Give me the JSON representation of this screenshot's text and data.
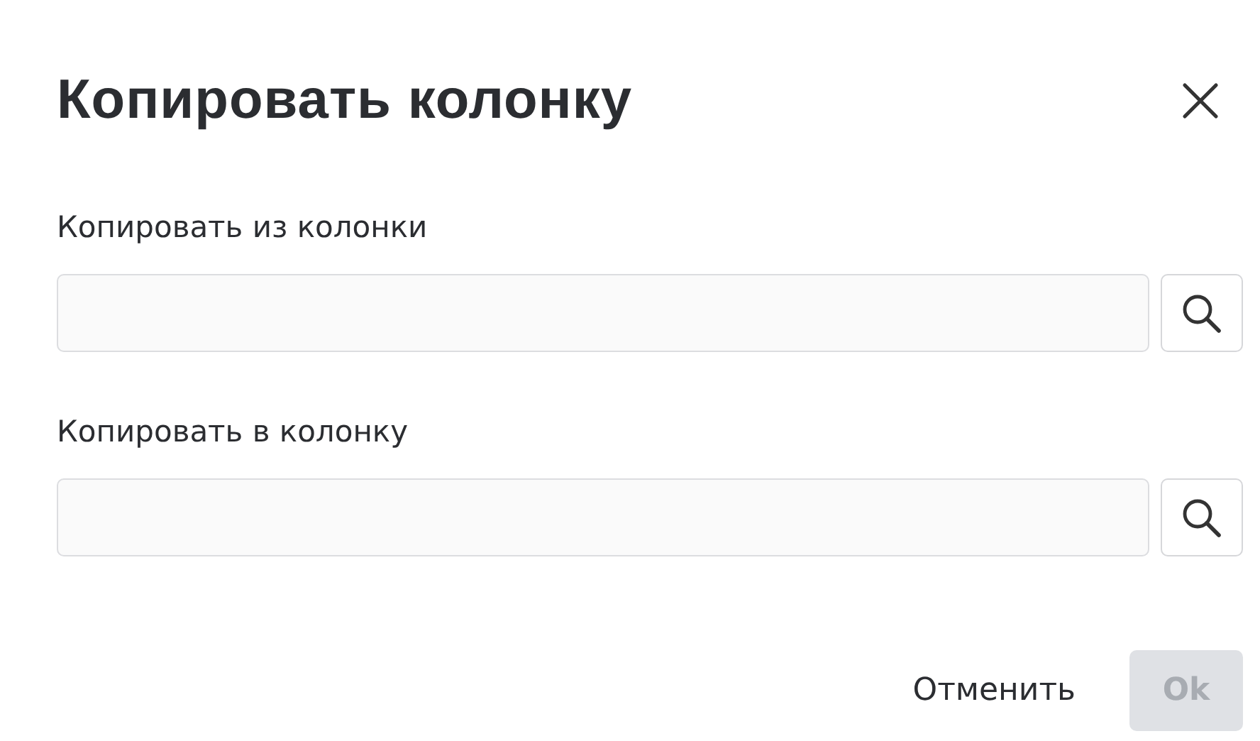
{
  "dialog": {
    "title": "Копировать колонку",
    "fields": [
      {
        "label": "Копировать из колонки"
      },
      {
        "label": "Копировать в колонку"
      }
    ],
    "buttons": [
      {
        "label": "Отменить",
        "kind": "text",
        "disabled": false
      },
      {
        "label": "Ok",
        "kind": "primary",
        "disabled": true
      }
    ]
  }
}
